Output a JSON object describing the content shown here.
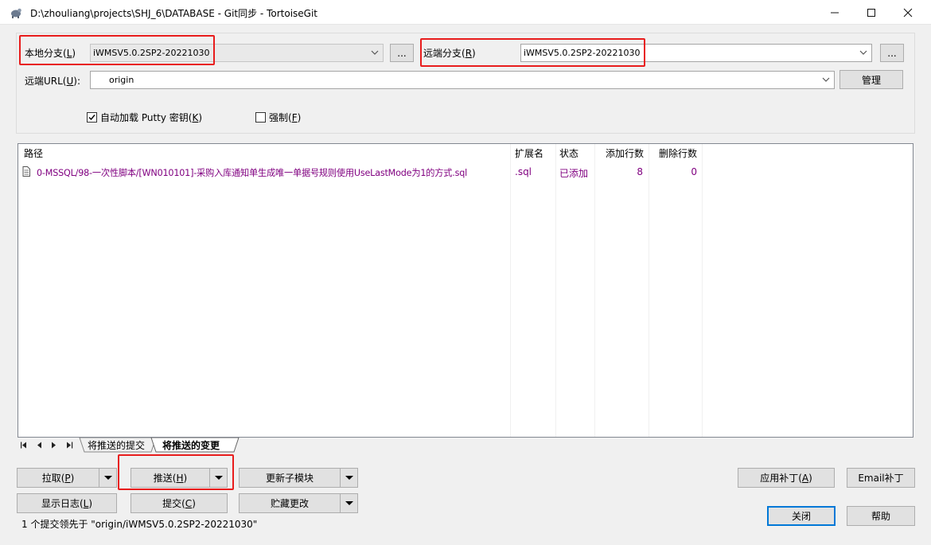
{
  "window": {
    "title": "D:\\zhouliang\\projects\\SHJ_6\\DATABASE - Git同步 - TortoiseGit"
  },
  "branch": {
    "local_label": "本地分支(",
    "local_key": "L",
    "local_close": ")",
    "local_value": "iWMSV5.0.2SP2-20221030",
    "remote_label": "远端分支(",
    "remote_key": "R",
    "remote_close": ")",
    "remote_value": "iWMSV5.0.2SP2-20221030",
    "url_label": "远端URL(",
    "url_key": "U",
    "url_close": "):",
    "url_value": "origin",
    "browse": "...",
    "manage": "管理"
  },
  "options": {
    "autoload_label": "自动加载 Putty 密钥(",
    "autoload_key": "K",
    "autoload_close": ")",
    "autoload_checked": true,
    "force_label": "强制(",
    "force_key": "F",
    "force_close": ")",
    "force_checked": false
  },
  "list": {
    "headers": [
      "路径",
      "扩展名",
      "状态",
      "添加行数",
      "删除行数"
    ],
    "rows": [
      {
        "path": "0-MSSQL/98-一次性脚本/[WN010101]-采购入库通知单生成唯一单据号规则使用UseLastMode为1的方式.sql",
        "ext": ".sql",
        "status": "已添加",
        "added": "8",
        "deleted": "0"
      }
    ]
  },
  "tabs": [
    {
      "label": "将推送的提交",
      "active": false
    },
    {
      "label": "将推送的变更",
      "active": true
    }
  ],
  "buttons": {
    "pull": "拉取(",
    "pull_key": "P",
    "pull_close": ")",
    "push": "推送(",
    "push_key": "H",
    "push_close": ")",
    "update_submodule": "更新子模块",
    "show_log": "显示日志(",
    "show_log_key": "L",
    "show_log_close": ")",
    "commit": "提交(",
    "commit_key": "C",
    "commit_close": ")",
    "stash": "贮藏更改",
    "apply_patch": "应用补丁(",
    "apply_patch_key": "A",
    "apply_patch_close": ")",
    "email_patch_a": "Email补丁",
    "close": "关闭",
    "help": "帮助"
  },
  "status_text": "1 个提交领先于 \"origin/iWMSV5.0.2SP2-20221030\"",
  "colors": {
    "highlight_box": "#e81c1c",
    "file_text": "#800080",
    "focus_blue": "#0078d7"
  }
}
